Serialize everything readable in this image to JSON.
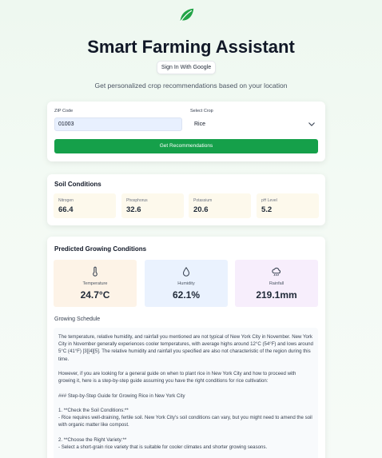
{
  "header": {
    "logo_icon": "leaf-icon",
    "title": "Smart Farming Assistant",
    "signin_label": "Sign In With Google",
    "subtitle": "Get personalized crop recommendations based on your location"
  },
  "form": {
    "zip_label": "ZIP Code",
    "zip_value": "01003",
    "crop_label": "Select Crop",
    "crop_value": "Rice",
    "submit_label": "Get Recommendations"
  },
  "soil": {
    "title": "Soil Conditions",
    "items": [
      {
        "label": "Nitrogen",
        "value": "66.4"
      },
      {
        "label": "Phosphorus",
        "value": "32.6"
      },
      {
        "label": "Potassium",
        "value": "20.6"
      },
      {
        "label": "pH Level",
        "value": "5.2"
      }
    ]
  },
  "predicted": {
    "title": "Predicted Growing Conditions",
    "temperature": {
      "label": "Temperature",
      "value": "24.7°C",
      "icon": "thermometer-icon"
    },
    "humidity": {
      "label": "Humidity",
      "value": "62.1%",
      "icon": "droplet-icon"
    },
    "rainfall": {
      "label": "Rainfall",
      "value": "219.1mm",
      "icon": "cloud-rain-icon"
    },
    "schedule_label": "Growing Schedule",
    "schedule_paragraphs": [
      "The temperature, relative humidity, and rainfall you mentioned are not typical of New York City in November. New York City in November generally experiences cooler temperatures, with average highs around 12°C (54°F) and lows around 5°C (41°F) [3][4][5]. The relative humidity and rainfall you specified are also not characteristic of the region during this time.",
      "However, if you are looking for a general guide on when to plant rice in New York City and how to proceed with growing it, here is a step-by-step guide assuming you have the right conditions for rice cultivation:",
      "### Step-by-Step Guide for Growing Rice in New York City",
      "1. **Check the Soil Conditions:**",
      "- Rice requires well-draining, fertile soil. New York City's soil conditions can vary, but you might need to amend the soil with organic matter like compost.",
      "2. **Choose the Right Variety:**",
      "- Select a short-grain rice variety that is suitable for cooler climates and shorter growing seasons."
    ]
  },
  "colors": {
    "accent": "#15a04a",
    "temperature_bg": "#fdf3e7",
    "humidity_bg": "#eaf2fe",
    "rainfall_bg": "#f7eefc",
    "soil_bg": "#fdf9ec"
  }
}
